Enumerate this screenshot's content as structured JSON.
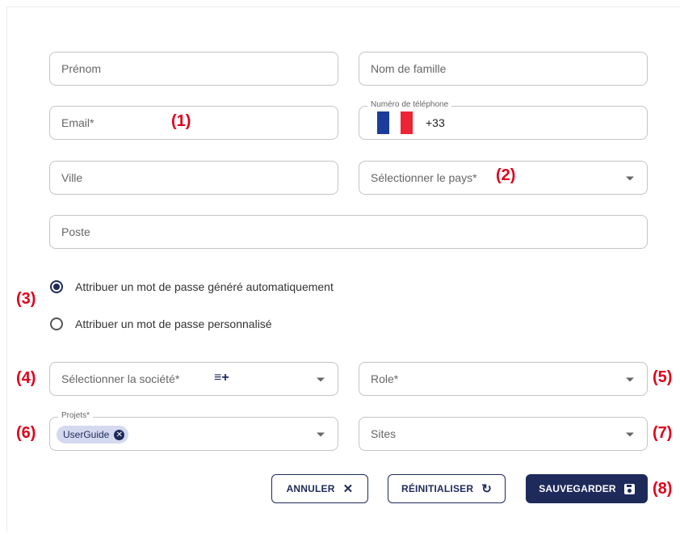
{
  "form": {
    "first_name": {
      "placeholder": "Prénom"
    },
    "last_name": {
      "placeholder": "Nom de famille"
    },
    "email": {
      "placeholder": "Email*"
    },
    "phone": {
      "legend": "Numéro de téléphone",
      "dial_code": "+33",
      "country_flag": "france-flag"
    },
    "city": {
      "placeholder": "Ville"
    },
    "country": {
      "placeholder": "Sélectionner le pays*"
    },
    "position": {
      "placeholder": "Poste"
    },
    "password_options": [
      {
        "label": "Attribuer un mot de passe généré automatiquement",
        "selected": true
      },
      {
        "label": "Attribuer un mot de passe personnalisé",
        "selected": false
      }
    ],
    "company": {
      "placeholder": "Sélectionner la société*"
    },
    "role": {
      "placeholder": "Role*"
    },
    "projects": {
      "legend": "Projets*",
      "chips": [
        "UserGuide"
      ]
    },
    "sites": {
      "placeholder": "Sites"
    }
  },
  "buttons": {
    "cancel": "ANNULER",
    "reset": "RÉINITIALISER",
    "save": "SAUVEGARDER"
  },
  "annotations": [
    "(1)",
    "(2)",
    "(3)",
    "(4)",
    "(5)",
    "(6)",
    "(7)",
    "(8)"
  ],
  "colors": {
    "primary": "#1e2a5a",
    "annotation": "#e0001b",
    "chip_bg": "#d4d9ef",
    "flag_blue": "#1c3c9c",
    "flag_red": "#ee2436"
  }
}
